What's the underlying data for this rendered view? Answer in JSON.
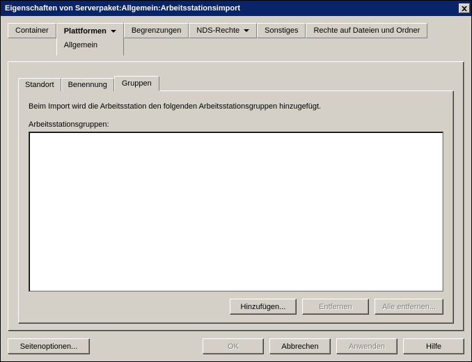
{
  "title": "Eigenschaften von Serverpaket:Allgemein:Arbeitsstationsimport",
  "topTabs": {
    "container": "Container",
    "plattformen": {
      "label": "Plattformen",
      "sublabel": "Allgemein"
    },
    "begrenzungen": "Begrenzungen",
    "nds_rechte": "NDS-Rechte",
    "sonstiges": "Sonstiges",
    "rechte_dateien": "Rechte auf Dateien und Ordner"
  },
  "innerTabs": {
    "standort": "Standort",
    "benennung": "Benennung",
    "gruppen": "Gruppen"
  },
  "content": {
    "info": "Beim Import wird die Arbeitsstation den folgenden Arbeitsstationsgruppen hinzugefügt.",
    "listLabel": "Arbeitsstationsgruppen:"
  },
  "listButtons": {
    "add": "Hinzufügen...",
    "remove": "Entfernen",
    "removeAll": "Alle entfernen..."
  },
  "dialogButtons": {
    "pageOptions": "Seitenoptionen...",
    "ok": "OK",
    "cancel": "Abbrechen",
    "apply": "Anwenden",
    "help": "Hilfe"
  }
}
